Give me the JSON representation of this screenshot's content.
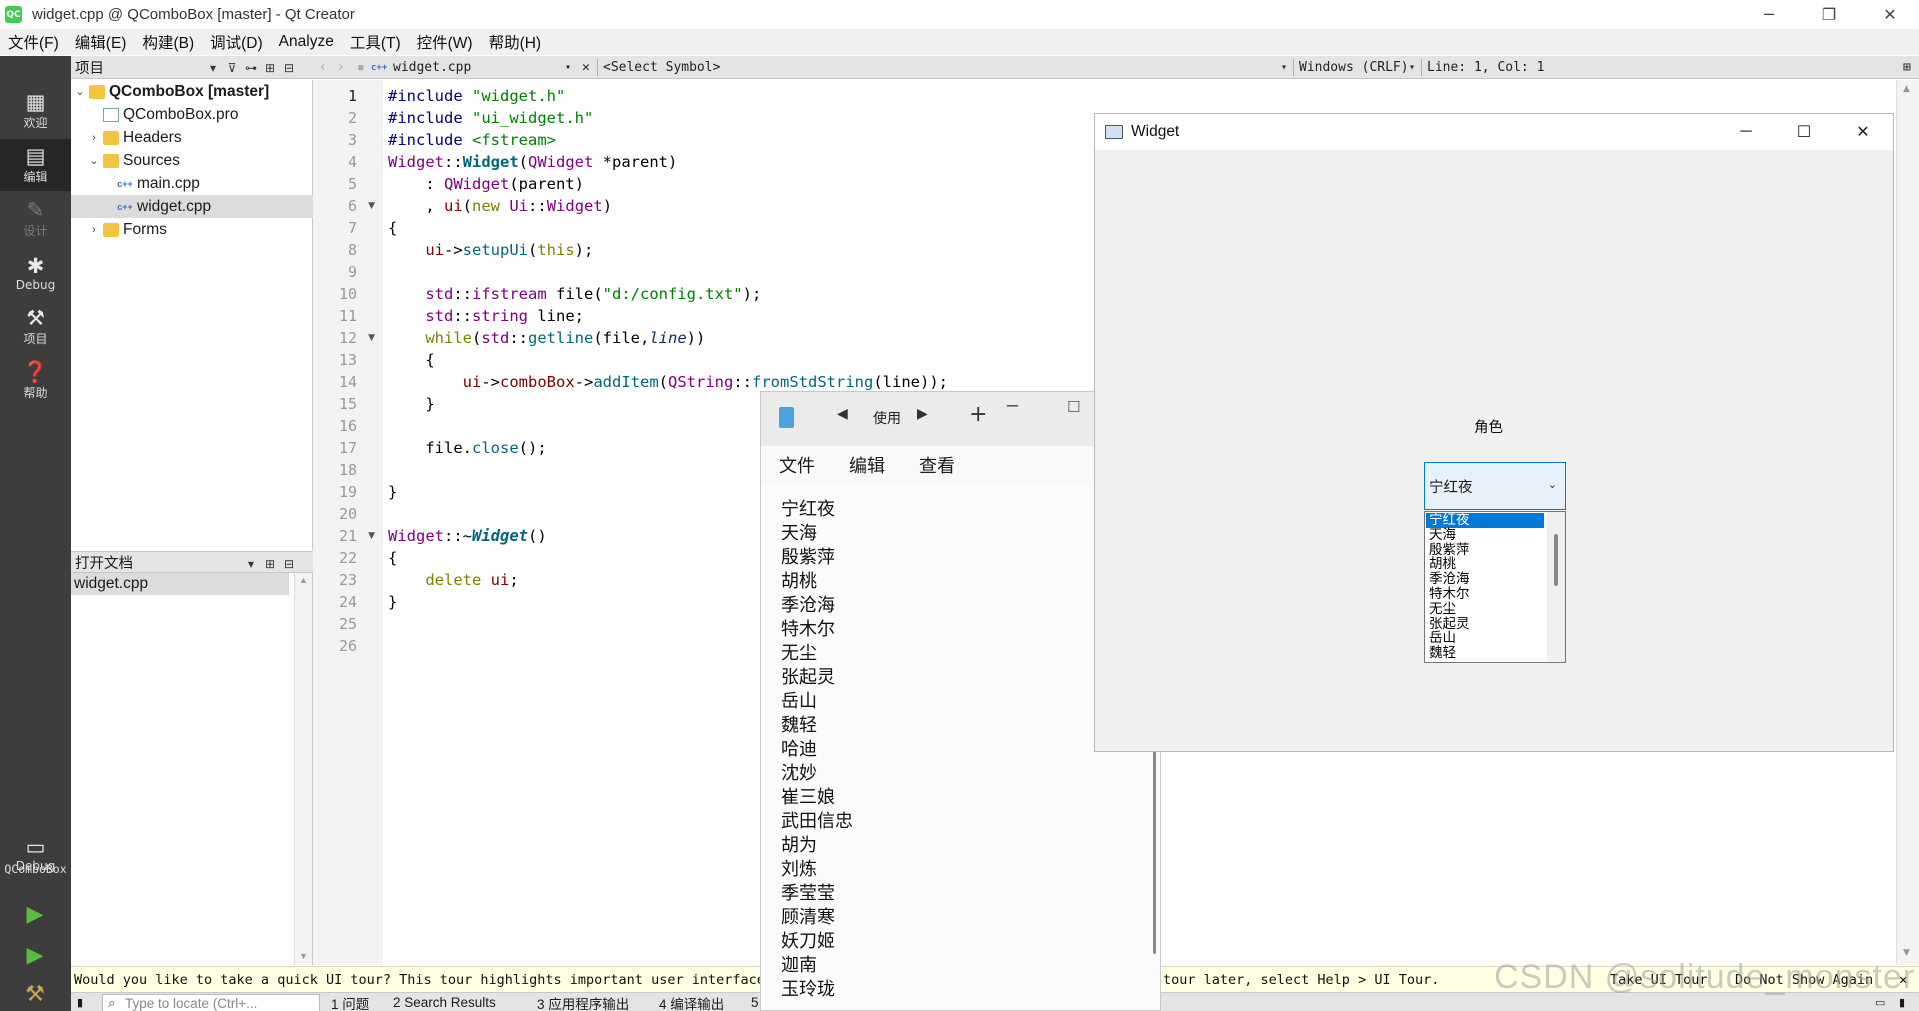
{
  "window": {
    "title": "widget.cpp @ QComboBox [master] - Qt Creator",
    "logo_text": "QC"
  },
  "menubar": [
    "文件(F)",
    "编辑(E)",
    "构建(B)",
    "调试(D)",
    "Analyze",
    "工具(T)",
    "控件(W)",
    "帮助(H)"
  ],
  "modes": {
    "welcome": "欢迎",
    "edit": "编辑",
    "design": "设计",
    "debug": "Debug",
    "projects": "项目",
    "help": "帮助",
    "kit_name": "QComboBox",
    "kit_config": "Debug"
  },
  "sidebar": {
    "header": "项目",
    "tree": [
      {
        "label": "QComboBox [master]"
      },
      {
        "label": "QComboBox.pro"
      },
      {
        "label": "Headers"
      },
      {
        "label": "Sources"
      },
      {
        "label": "main.cpp"
      },
      {
        "label": "widget.cpp"
      },
      {
        "label": "Forms"
      }
    ],
    "open_docs_header": "打开文档",
    "open_docs": [
      "widget.cpp"
    ]
  },
  "editor": {
    "file_name": "widget.cpp",
    "symbol": "<Select Symbol>",
    "line_ending": "Windows (CRLF)",
    "position": "Line: 1, Col: 1"
  },
  "tour": {
    "text_left": "Would you like to take a quick UI tour? This tour highlights important user interface",
    "text_right": "tour later, select Help > UI Tour.",
    "take_tour": "Take UI Tour",
    "do_not_show": "Do Not Show Again"
  },
  "statusbar": {
    "locate_placeholder": "Type to locate (Ctrl+...",
    "panes": [
      "1 问题",
      "2 Search Results",
      "3 应用程序输出",
      "4 编译输出"
    ],
    "trailing": "5"
  },
  "notepad": {
    "tab_label": "使用",
    "menus": [
      "文件",
      "编辑",
      "查看"
    ],
    "lines": [
      "宁红夜",
      "天海",
      "殷紫萍",
      "胡桃",
      "季沧海",
      "特木尔",
      "无尘",
      "张起灵",
      "岳山",
      "魏轻",
      "哈迪",
      "沈妙",
      "崔三娘",
      "武田信忠",
      "胡为",
      "刘炼",
      "季莹莹",
      "顾清寒",
      "妖刀姬",
      "迦南",
      "玉玲珑"
    ]
  },
  "widget_window": {
    "title": "Widget",
    "role_label": "角色",
    "combo_value": "宁红夜",
    "popup_items": [
      "宁红夜",
      "天海",
      "殷紫萍",
      "胡桃",
      "季沧海",
      "特木尔",
      "无尘",
      "张起灵",
      "岳山",
      "魏轻"
    ]
  },
  "watermark": "CSDN @solitude_monster"
}
